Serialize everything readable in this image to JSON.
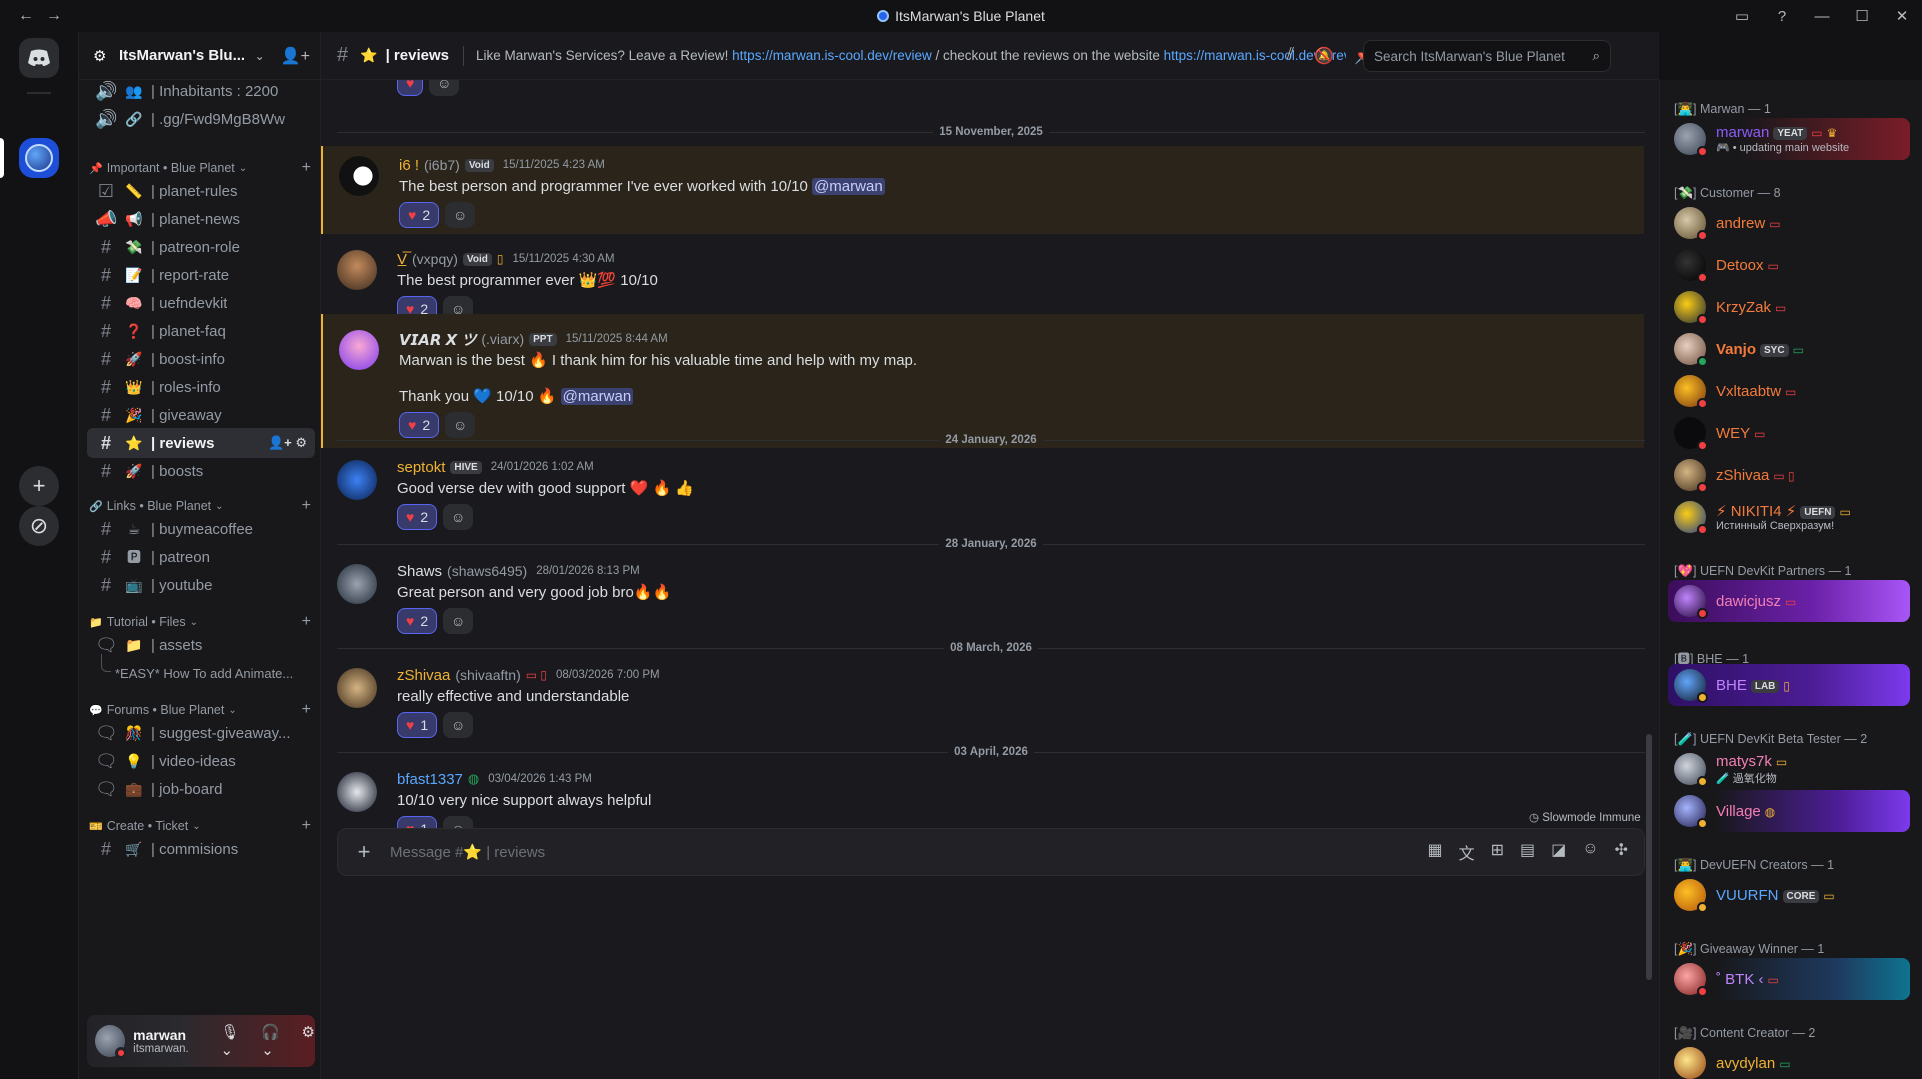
{
  "window": {
    "title": "ItsMarwan's Blue Planet",
    "back": "←",
    "forward": "→"
  },
  "server": {
    "name": "ItsMarwan's Blu...",
    "chevron": "⌄"
  },
  "sidebar": {
    "top_channels": [
      {
        "emoji": "👥",
        "label": "| Inhabitants : 2200",
        "icon": "speaker-icon"
      },
      {
        "emoji": "🔗",
        "label": "| .gg/Fwd9MgB8Ww",
        "icon": "speaker-icon"
      }
    ],
    "categories": [
      {
        "emoji": "📌",
        "name": "Important • Blue Planet"
      },
      {
        "emoji": "🔗",
        "name": "Links • Blue Planet"
      },
      {
        "emoji": "📁",
        "name": "Tutorial • Files"
      },
      {
        "emoji": "💬",
        "name": "Forums • Blue Planet"
      },
      {
        "emoji": "🎫",
        "name": "Create • Ticket"
      }
    ],
    "important": [
      {
        "emoji": "📏",
        "label": "| planet-rules"
      },
      {
        "emoji": "📢",
        "label": "| planet-news"
      },
      {
        "emoji": "💸",
        "label": "| patreon-role"
      },
      {
        "emoji": "📝",
        "label": "| report-rate"
      },
      {
        "emoji": "🧠",
        "label": "| uefndevkit"
      },
      {
        "emoji": "❓",
        "label": "| planet-faq"
      },
      {
        "emoji": "🚀",
        "label": "| boost-info"
      },
      {
        "emoji": "👑",
        "label": "| roles-info"
      },
      {
        "emoji": "🎉",
        "label": "| giveaway"
      },
      {
        "emoji": "⭐",
        "label": "| reviews"
      },
      {
        "emoji": "🚀",
        "label": "| boosts"
      }
    ],
    "links": [
      {
        "emoji": "☕",
        "label": "| buymeacoffee"
      },
      {
        "emoji": "🅿",
        "label": "| patreon"
      },
      {
        "emoji": "📺",
        "label": "| youtube"
      }
    ],
    "tutorial": [
      {
        "emoji": "📁",
        "label": "| assets"
      },
      {
        "emoji": "",
        "label": "*EASY* How To add Animate..."
      }
    ],
    "forums": [
      {
        "emoji": "🎊",
        "label": "| suggest-giveaway..."
      },
      {
        "emoji": "💡",
        "label": "| video-ideas"
      },
      {
        "emoji": "💼",
        "label": "| job-board"
      }
    ],
    "ticket": [
      {
        "emoji": "🛒",
        "label": "| commisions"
      }
    ]
  },
  "user": {
    "name": "marwan",
    "tag": "itsmarwan."
  },
  "channel": {
    "title": "| reviews",
    "emoji": "⭐",
    "topic_pre": "Like Marwan's Services? Leave a Review! ",
    "topic_link1": "https://marwan.is-cool.dev/review",
    "topic_mid": " / checkout the reviews on the website ",
    "topic_link2": "https://marwan.is-cool.dev/#reviews",
    "search_placeholder": "Search ItsMarwan's Blue Planet"
  },
  "dividers": [
    "15 November, 2025",
    "24 January, 2026",
    "28 January, 2026",
    "08 March, 2026",
    "03 April, 2026"
  ],
  "messages": [
    {
      "author": "i6 !",
      "handle": "(i6b7)",
      "tag": "Void",
      "ts": "15/11/2025 4:23 AM",
      "text": "The best person and programmer I've ever worked with 10/10",
      "mention": "@marwan",
      "react": "2",
      "color": "#f0b232"
    },
    {
      "author": "V̲̅",
      "handle": "(vxpqy)",
      "tag": "Void",
      "ts": "15/11/2025 4:30 AM",
      "text": "The best programmer ever 👑💯 10/10",
      "react": "2",
      "color": "#f0b232"
    },
    {
      "author": "𝙑𝙄𝘼𝙍 𝙓 ツ",
      "handle": "(.viarx)",
      "tag": "PPT",
      "ts": "15/11/2025 8:44 AM",
      "text": "Marwan is the best 🔥 I thank him for his valuable time and help with my map.",
      "text2": "Thank you 💙 10/10 🔥",
      "mention": "@marwan",
      "react": "2",
      "color": "#dbdee1"
    },
    {
      "author": "septokt",
      "handle": "",
      "tag": "HIVE",
      "ts": "24/01/2026 1:02 AM",
      "text": "Good verse dev with good support ❤️ 🔥 👍",
      "react": "2",
      "color": "#f0b232"
    },
    {
      "author": "Shaws",
      "handle": "(shaws6495)",
      "tag": "",
      "ts": "28/01/2026 8:13 PM",
      "text": "Great person and very good job bro🔥🔥",
      "react": "2",
      "color": "#dbdee1"
    },
    {
      "author": "zShivaa",
      "handle": "(shivaaftn)",
      "tag": "",
      "ts": "08/03/2026 7:00 PM",
      "text": "really effective and understandable",
      "react": "1",
      "color": "#f0b232"
    },
    {
      "author": "bfast1337",
      "handle": "",
      "tag": "",
      "ts": "03/04/2026 1:43 PM",
      "text": "10/10 very nice support always helpful",
      "react": "1",
      "color": "#5aa7ff"
    }
  ],
  "composer": {
    "placeholder": "Message #⭐ | reviews",
    "slowmode": "Slowmode Immune"
  },
  "members": {
    "groups": [
      "[👨‍💻] Marwan — 1",
      "[💸] Customer — 8",
      "[💖] UEFN DevKit Partners — 1",
      "[🅱] BHE — 1",
      "[🧪] UEFN DevKit Beta Tester — 2",
      "[👨‍💻] DevUEFN Creators — 1",
      "[🎉] Giveaway Winner — 1",
      "[🎥] Content Creator — 2"
    ],
    "list": [
      {
        "name": "marwan",
        "tag": "YEAT",
        "status": "🎮 • updating main website",
        "color": "#8b5cf6"
      },
      {
        "name": "andrew",
        "tag": "",
        "status": "",
        "color": "#f37b3a"
      },
      {
        "name": "Detoox",
        "tag": "",
        "status": "",
        "color": "#f37b3a"
      },
      {
        "name": "KrzyZak",
        "tag": "",
        "status": "",
        "color": "#f37b3a"
      },
      {
        "name": "Vanjo",
        "tag": "SYC",
        "status": "",
        "color": "#f37b3a"
      },
      {
        "name": "Vxltaabtw",
        "tag": "",
        "status": "",
        "color": "#f37b3a"
      },
      {
        "name": "WEY",
        "tag": "",
        "status": "",
        "color": "#f37b3a"
      },
      {
        "name": "zShivaa",
        "tag": "",
        "status": "",
        "color": "#f37b3a"
      },
      {
        "name": "⚡ NIKITI4 ⚡",
        "tag": "UEFN",
        "status": "Истинный Сверхразум!",
        "color": "#f37b3a"
      },
      {
        "name": "dawicjusz",
        "tag": "",
        "status": "",
        "color": "#f47fb5"
      },
      {
        "name": "BHE",
        "tag": "LAB",
        "status": "",
        "color": "#c084fc"
      },
      {
        "name": "matys7k",
        "tag": "",
        "status": "🧪 過氧化物",
        "color": "#f47fb5"
      },
      {
        "name": "Village",
        "tag": "",
        "status": "",
        "color": "#f47fb5"
      },
      {
        "name": "VUURFN",
        "tag": "CORE",
        "status": "",
        "color": "#5aa7ff"
      },
      {
        "name": "˚ BTK ‹",
        "tag": "",
        "status": "",
        "color": "#c084fc"
      },
      {
        "name": "avydylan",
        "tag": "",
        "status": "",
        "color": "#f0b232"
      }
    ]
  }
}
